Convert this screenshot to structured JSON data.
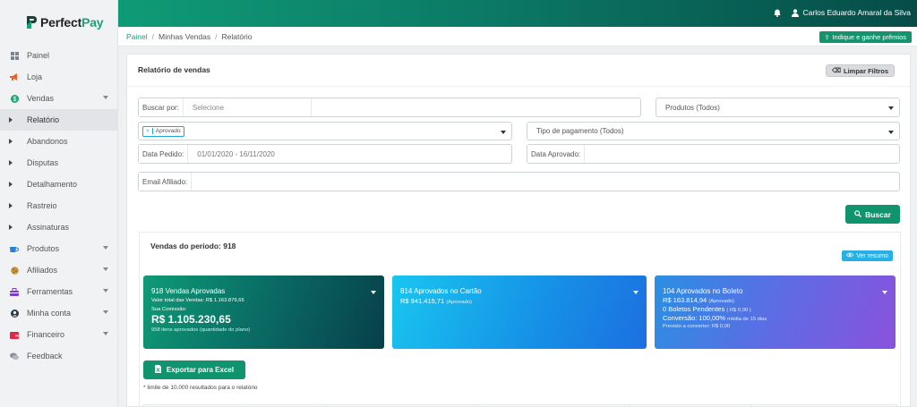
{
  "brand": {
    "name_a": "Perfect",
    "name_b": "Pay",
    "color": "#13946f"
  },
  "sidebar": {
    "items": [
      {
        "label": "Painel",
        "icon": "grid-icon",
        "caret": false
      },
      {
        "label": "Loja",
        "icon": "megaphone-icon",
        "caret": false
      },
      {
        "label": "Vendas",
        "icon": "dollar-icon",
        "caret": true
      },
      {
        "label": "Relatório",
        "icon": "triangle-icon",
        "caret": false,
        "active": true
      },
      {
        "label": "Abandonos",
        "icon": "triangle-icon",
        "caret": false
      },
      {
        "label": "Disputas",
        "icon": "triangle-icon",
        "caret": false
      },
      {
        "label": "Detalhamento",
        "icon": "triangle-icon",
        "caret": false
      },
      {
        "label": "Rastreio",
        "icon": "triangle-icon",
        "caret": false
      },
      {
        "label": "Assinaturas",
        "icon": "triangle-icon",
        "caret": false
      },
      {
        "label": "Produtos",
        "icon": "coffee-icon",
        "caret": true
      },
      {
        "label": "Afiliados",
        "icon": "cookie-icon",
        "caret": true
      },
      {
        "label": "Ferramentas",
        "icon": "toolbox-icon",
        "caret": true
      },
      {
        "label": "Minha conta",
        "icon": "user-circle-icon",
        "caret": true
      },
      {
        "label": "Financeiro",
        "icon": "wallet-icon",
        "caret": true
      },
      {
        "label": "Feedback",
        "icon": "chat-icon",
        "caret": false
      }
    ]
  },
  "topbar": {
    "user_name": "Carlos Eduardo Amaral da Silva"
  },
  "breadcrumb": {
    "home": "Painel",
    "section": "Minhas Vendas",
    "page": "Relatório"
  },
  "refer_button": "Indique e ganhe prêmios",
  "report": {
    "title": "Relatório de vendas",
    "clear_filters": "Limpar Filtros",
    "search_by_label": "Buscar por:",
    "search_by_placeholder": "Selecione",
    "products_select": "Produtos (Todos)",
    "status_tag": "Aprovado",
    "status_tag_remove": "×",
    "payment_type_select": "Tipo de pagamento (Todos)",
    "order_date_label": "Data Pedido:",
    "order_date_value": "01/01/2020 - 16/11/2020",
    "approved_date_label": "Data Aprovado:",
    "affiliate_email_label": "Email Afiliado:",
    "search_button": "Buscar"
  },
  "sales": {
    "title": "Vendas do período: 918",
    "summary_button": "Ver resumo",
    "card1": {
      "headline": "918 Vendas Aprovadas",
      "total_line": "Valor total das Vendas: R$ 1.163.879,65",
      "commission_label": "Sua Comissão:",
      "commission_value": "R$ 1.105.230,65",
      "items_line": "958 itens aprovados (quantidade do plano)"
    },
    "card2": {
      "headline": "814 Aprovados no Cartão",
      "amount": "R$ 941.415,71",
      "amount_note": "(Aprovado)"
    },
    "card3": {
      "headline": "104 Aprovados no Boleto",
      "amount": "R$ 163.814,94",
      "amount_note": "(Aprovado)",
      "pending": "0 Boletos Pendentes",
      "pending_note": "( R$ 0,00 )",
      "conversion": "Conversão: 100,00%",
      "conversion_note": "média de 15 dias",
      "forecast": "Previsto a converter: R$ 0,00"
    },
    "export_button": "Exportar para Excel",
    "limit_note": "* limite de 10.000 resultados para o relatório"
  }
}
